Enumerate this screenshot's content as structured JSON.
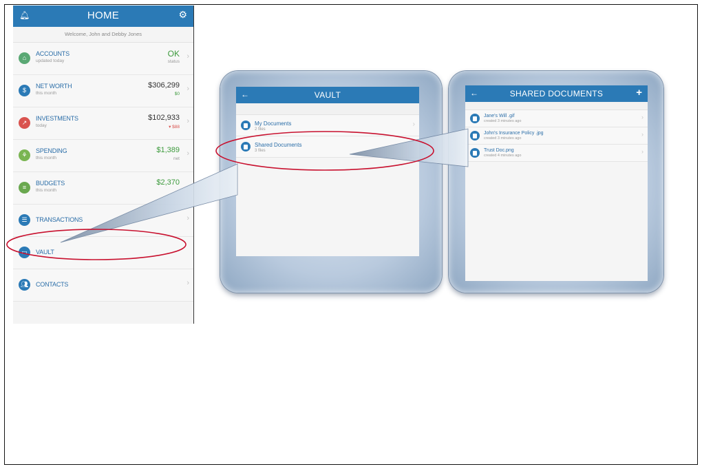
{
  "home": {
    "title": "HOME",
    "welcome": "Welcome, John and Debby Jones",
    "items": [
      {
        "label": "ACCOUNTS",
        "sub": "updated today",
        "value": "OK",
        "value2": "status",
        "icon": "bank-icon",
        "color": "#5aa874"
      },
      {
        "label": "NET WORTH",
        "sub": "this month",
        "value": "$306,299",
        "value2": "$0",
        "icon": "dollar-icon",
        "color": "#2b7ab6"
      },
      {
        "label": "INVESTMENTS",
        "sub": "today",
        "value": "$102,933",
        "value2": "▾ $88",
        "icon": "chart-icon",
        "color": "#d9534f"
      },
      {
        "label": "SPENDING",
        "sub": "this month",
        "value": "$1,389",
        "value2": "net",
        "icon": "leaf-icon",
        "color": "#7ab552"
      },
      {
        "label": "BUDGETS",
        "sub": "this month",
        "value": "$2,370",
        "value2": "",
        "icon": "budget-icon",
        "color": "#6aa84f"
      },
      {
        "label": "TRANSACTIONS",
        "sub": "",
        "value": "",
        "value2": "",
        "icon": "list-icon",
        "color": "#2b7ab6"
      },
      {
        "label": "VAULT",
        "sub": "",
        "value": "",
        "value2": "",
        "icon": "folder-icon",
        "color": "#2b7ab6"
      },
      {
        "label": "CONTACTS",
        "sub": "",
        "value": "",
        "value2": "",
        "icon": "people-icon",
        "color": "#2b7ab6"
      }
    ]
  },
  "vault": {
    "title": "VAULT",
    "items": [
      {
        "label": "My Documents",
        "sub": "2 files"
      },
      {
        "label": "Shared Documents",
        "sub": "3 files"
      }
    ]
  },
  "shared": {
    "title": "SHARED DOCUMENTS",
    "items": [
      {
        "label": "Jane's Will .gif",
        "sub": "created 3 minutes ago"
      },
      {
        "label": "John's Insurance Policy .jpg",
        "sub": "created 3 minutes ago"
      },
      {
        "label": "Trust Doc.png",
        "sub": "created 4 minutes ago"
      }
    ]
  },
  "colors": {
    "header": "#2b7ab6",
    "highlight": "#c8102e",
    "positive": "#3c9a3c",
    "negative": "#d9534f"
  }
}
